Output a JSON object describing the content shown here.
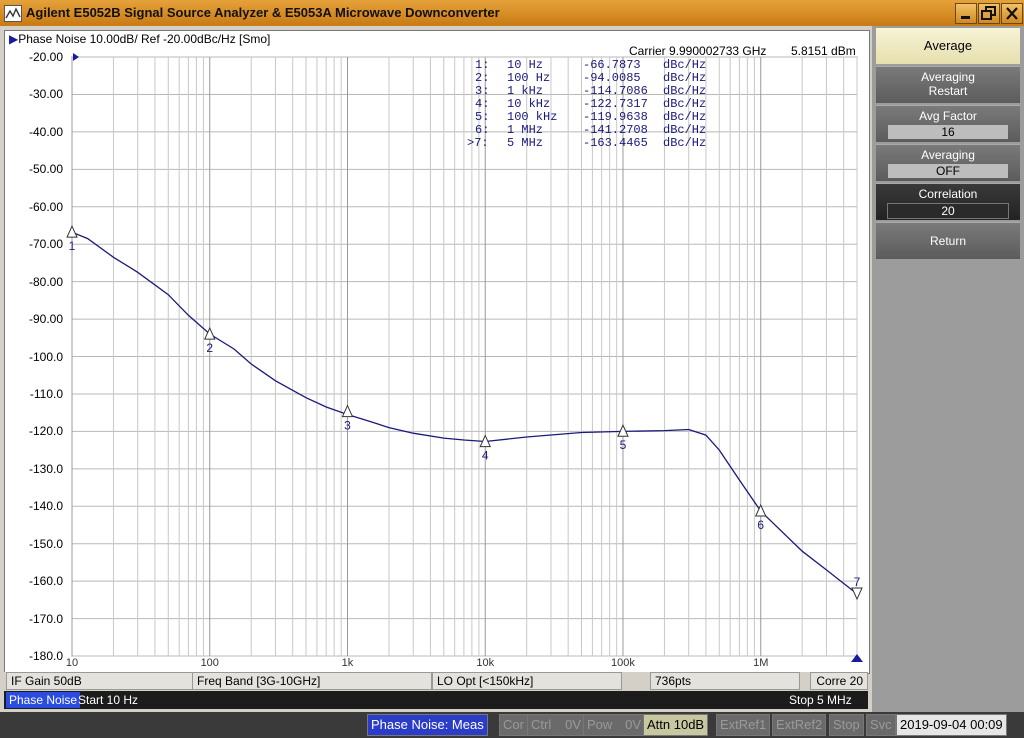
{
  "window": {
    "title": "Agilent E5052B Signal Source Analyzer & E5053A Microwave Downconverter",
    "min_icon": "minimize-icon",
    "restore_icon": "restore-icon",
    "close_icon": "close-icon"
  },
  "trace": {
    "header": "Phase Noise 10.00dB/ Ref -20.00dBc/Hz [Smo]",
    "carrier": "Carrier 9.990002733 GHz",
    "carrier_power": "5.8151 dBm",
    "color": "#1a1a7a"
  },
  "chart_data": {
    "type": "line",
    "xscale": "log",
    "xlim": [
      10,
      5000000
    ],
    "ylim": [
      -180,
      -20
    ],
    "yticks": [
      "-20.00",
      "-30.00",
      "-40.00",
      "-50.00",
      "-60.00",
      "-70.00",
      "-80.00",
      "-90.00",
      "-100.0",
      "-110.0",
      "-120.0",
      "-130.0",
      "-140.0",
      "-150.0",
      "-160.0",
      "-170.0",
      "-180.0"
    ],
    "xticks": [
      "10",
      "100",
      "1k",
      "10k",
      "100k",
      "1M"
    ],
    "grid": true,
    "series": [
      {
        "x": [
          10,
          13,
          20,
          30,
          50,
          70,
          100,
          150,
          200,
          300,
          500,
          700,
          1000,
          1500,
          2000,
          3000,
          5000,
          7000,
          10000,
          20000,
          50000,
          100000,
          200000,
          300000,
          400000,
          500000,
          700000,
          1000000,
          2000000,
          3000000,
          5000000
        ],
        "y": [
          -66.8,
          -68.5,
          -73.5,
          -77.5,
          -83.5,
          -89,
          -94,
          -98,
          -102,
          -106.5,
          -111,
          -113.5,
          -115.5,
          -117.5,
          -119,
          -120.5,
          -121.8,
          -122.3,
          -122.7,
          -121.5,
          -120.3,
          -120,
          -119.8,
          -119.5,
          -121,
          -125,
          -133,
          -141.3,
          -152,
          -157,
          -163.4
        ]
      }
    ],
    "markers": [
      {
        "n": "1",
        "x": 10,
        "y": -66.7873
      },
      {
        "n": "2",
        "x": 100,
        "y": -94.0085
      },
      {
        "n": "3",
        "x": 1000,
        "y": -114.7086
      },
      {
        "n": "4",
        "x": 10000,
        "y": -122.7317
      },
      {
        "n": "5",
        "x": 100000,
        "y": -119.9638
      },
      {
        "n": "6",
        "x": 1000000,
        "y": -141.2708
      },
      {
        "n": "7",
        "x": 5000000,
        "y": -163.4465
      }
    ]
  },
  "marker_table": [
    {
      "idx": "1:",
      "freq": "10 Hz",
      "val": "-66.7873",
      "unit": "dBc/Hz"
    },
    {
      "idx": "2:",
      "freq": "100 Hz",
      "val": "-94.0085",
      "unit": "dBc/Hz"
    },
    {
      "idx": "3:",
      "freq": "1 kHz",
      "val": "-114.7086",
      "unit": "dBc/Hz"
    },
    {
      "idx": "4:",
      "freq": "10 kHz",
      "val": "-122.7317",
      "unit": "dBc/Hz"
    },
    {
      "idx": "5:",
      "freq": "100 kHz",
      "val": "-119.9638",
      "unit": "dBc/Hz"
    },
    {
      "idx": "6:",
      "freq": "1 MHz",
      "val": "-141.2708",
      "unit": "dBc/Hz"
    },
    {
      "idx": ">7:",
      "freq": "5 MHz",
      "val": "-163.4465",
      "unit": "dBc/Hz"
    }
  ],
  "status": {
    "if_gain": "IF Gain 50dB",
    "freq_band": "Freq Band [3G-10GHz]",
    "lo_opt": "LO Opt [<150kHz]",
    "points": "736pts",
    "corre": "Corre 20"
  },
  "channel": {
    "meas_label": "Phase Noise",
    "start": "Start 10 Hz",
    "stop": "Stop 5 MHz"
  },
  "instrument": {
    "meas": "Phase Noise: Meas",
    "cor": "Cor",
    "ctrl": "Ctrl",
    "ctrl_val": "0V",
    "pow": "Pow",
    "pow_val": "0V",
    "attn": "Attn 10dB",
    "extref1": "ExtRef1",
    "extref2": "ExtRef2",
    "stop": "Stop",
    "svc": "Svc",
    "datetime": "2019-09-04 00:09"
  },
  "softkeys": {
    "menu_title": "Average",
    "averaging_restart": [
      "Averaging",
      "Restart"
    ],
    "avg_factor": {
      "label": "Avg Factor",
      "value": "16"
    },
    "averaging": {
      "label": "Averaging",
      "value": "OFF"
    },
    "correlation": {
      "label": "Correlation",
      "value": "20"
    },
    "return": "Return"
  }
}
